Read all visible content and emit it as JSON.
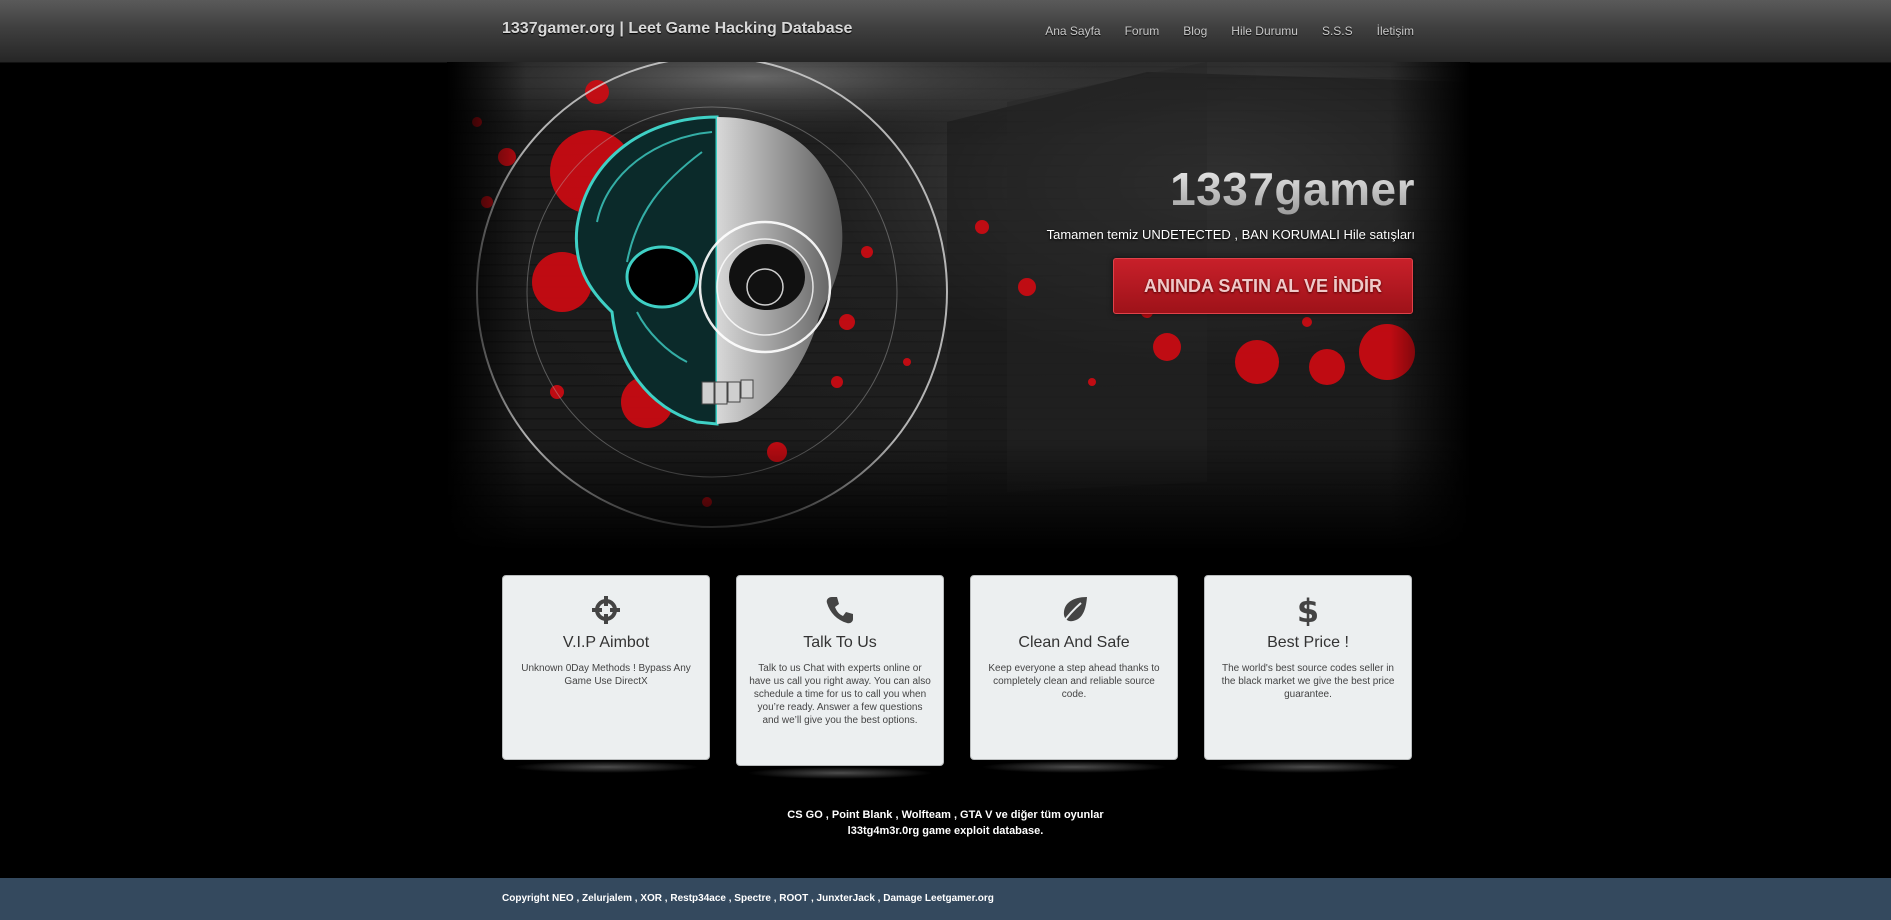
{
  "header": {
    "brand": "1337gamer.org | Leet Game Hacking Database",
    "nav": [
      {
        "label": "Ana Sayfa"
      },
      {
        "label": "Forum"
      },
      {
        "label": "Blog"
      },
      {
        "label": "Hile Durumu"
      },
      {
        "label": "S.S.S"
      },
      {
        "label": "İletişim"
      }
    ]
  },
  "hero": {
    "title": "1337gamer",
    "subtitle": "Tamamen temiz UNDETECTED , BAN KORUMALI Hile satışları",
    "cta_label": "ANINDA SATIN AL VE İNDİR"
  },
  "features": [
    {
      "icon": "crosshair-icon",
      "title": "V.I.P Aimbot",
      "text": "Unknown 0Day Methods ! Bypass Any Game Use DirectX"
    },
    {
      "icon": "phone-icon",
      "title": "Talk To Us",
      "text": "Talk to us Chat with experts online or have us call you right away. You can also schedule a time for us to call you when you’re ready. Answer a few questions and we’ll give you the best options."
    },
    {
      "icon": "leaf-icon",
      "title": "Clean And Safe",
      "text": "Keep everyone a step ahead thanks to completely clean and reliable source code."
    },
    {
      "icon": "dollar-icon",
      "title": "Best Price !",
      "text": "The world's best source codes seller in the black market we give the best price guarantee."
    }
  ],
  "games_line1": "CS GO , Point Blank , Wolfteam , GTA V ve diğer tüm oyunlar",
  "games_line2": "l33tg4m3r.0rg game exploit database.",
  "footer": "Copyright NEO , Zelurjalem , XOR , Restp34ace , Spectre , ROOT , JunxterJack , Damage Leetgamer.org",
  "colors": {
    "cta": "#b5171f",
    "footer_bg": "#34495e",
    "card_bg": "#eceff0",
    "skull_cyan": "#3fd0c5",
    "blood": "#d10a12"
  }
}
